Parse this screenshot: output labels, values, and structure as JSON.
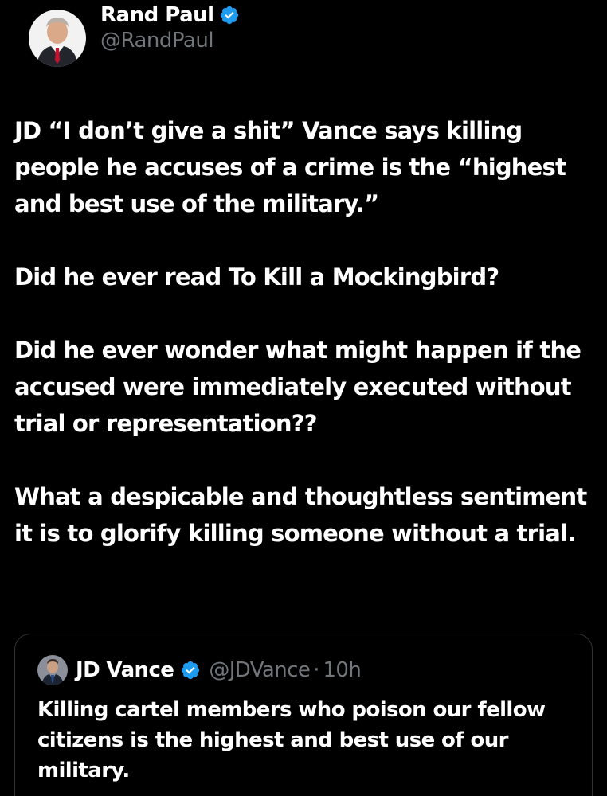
{
  "author": {
    "display_name": "Rand Paul",
    "handle": "@RandPaul",
    "verified": true
  },
  "tweet": {
    "paragraphs": [
      "JD “I don’t give a shit” Vance says killing people he accuses of a crime is the “highest and best use of the military.”",
      "Did he ever read To Kill a Mockingbird?",
      "Did he ever wonder what might happen if the accused were immediately executed without trial or representation??",
      "What a despicable and thoughtless sentiment it is to glorify killing someone without a trial."
    ]
  },
  "quoted_tweet": {
    "display_name": "JD Vance",
    "handle": "@JDVance",
    "separator": "·",
    "time": "10h",
    "verified": true,
    "text": "Killing cartel members who poison our fellow citizens is the highest and best use of our military."
  },
  "colors": {
    "background": "#000000",
    "text": "#ffffff",
    "muted": "#71767b",
    "verified_badge": "#1d9bf0",
    "border": "#2f3336"
  },
  "icons": {
    "verified": "verified-badge-icon"
  }
}
